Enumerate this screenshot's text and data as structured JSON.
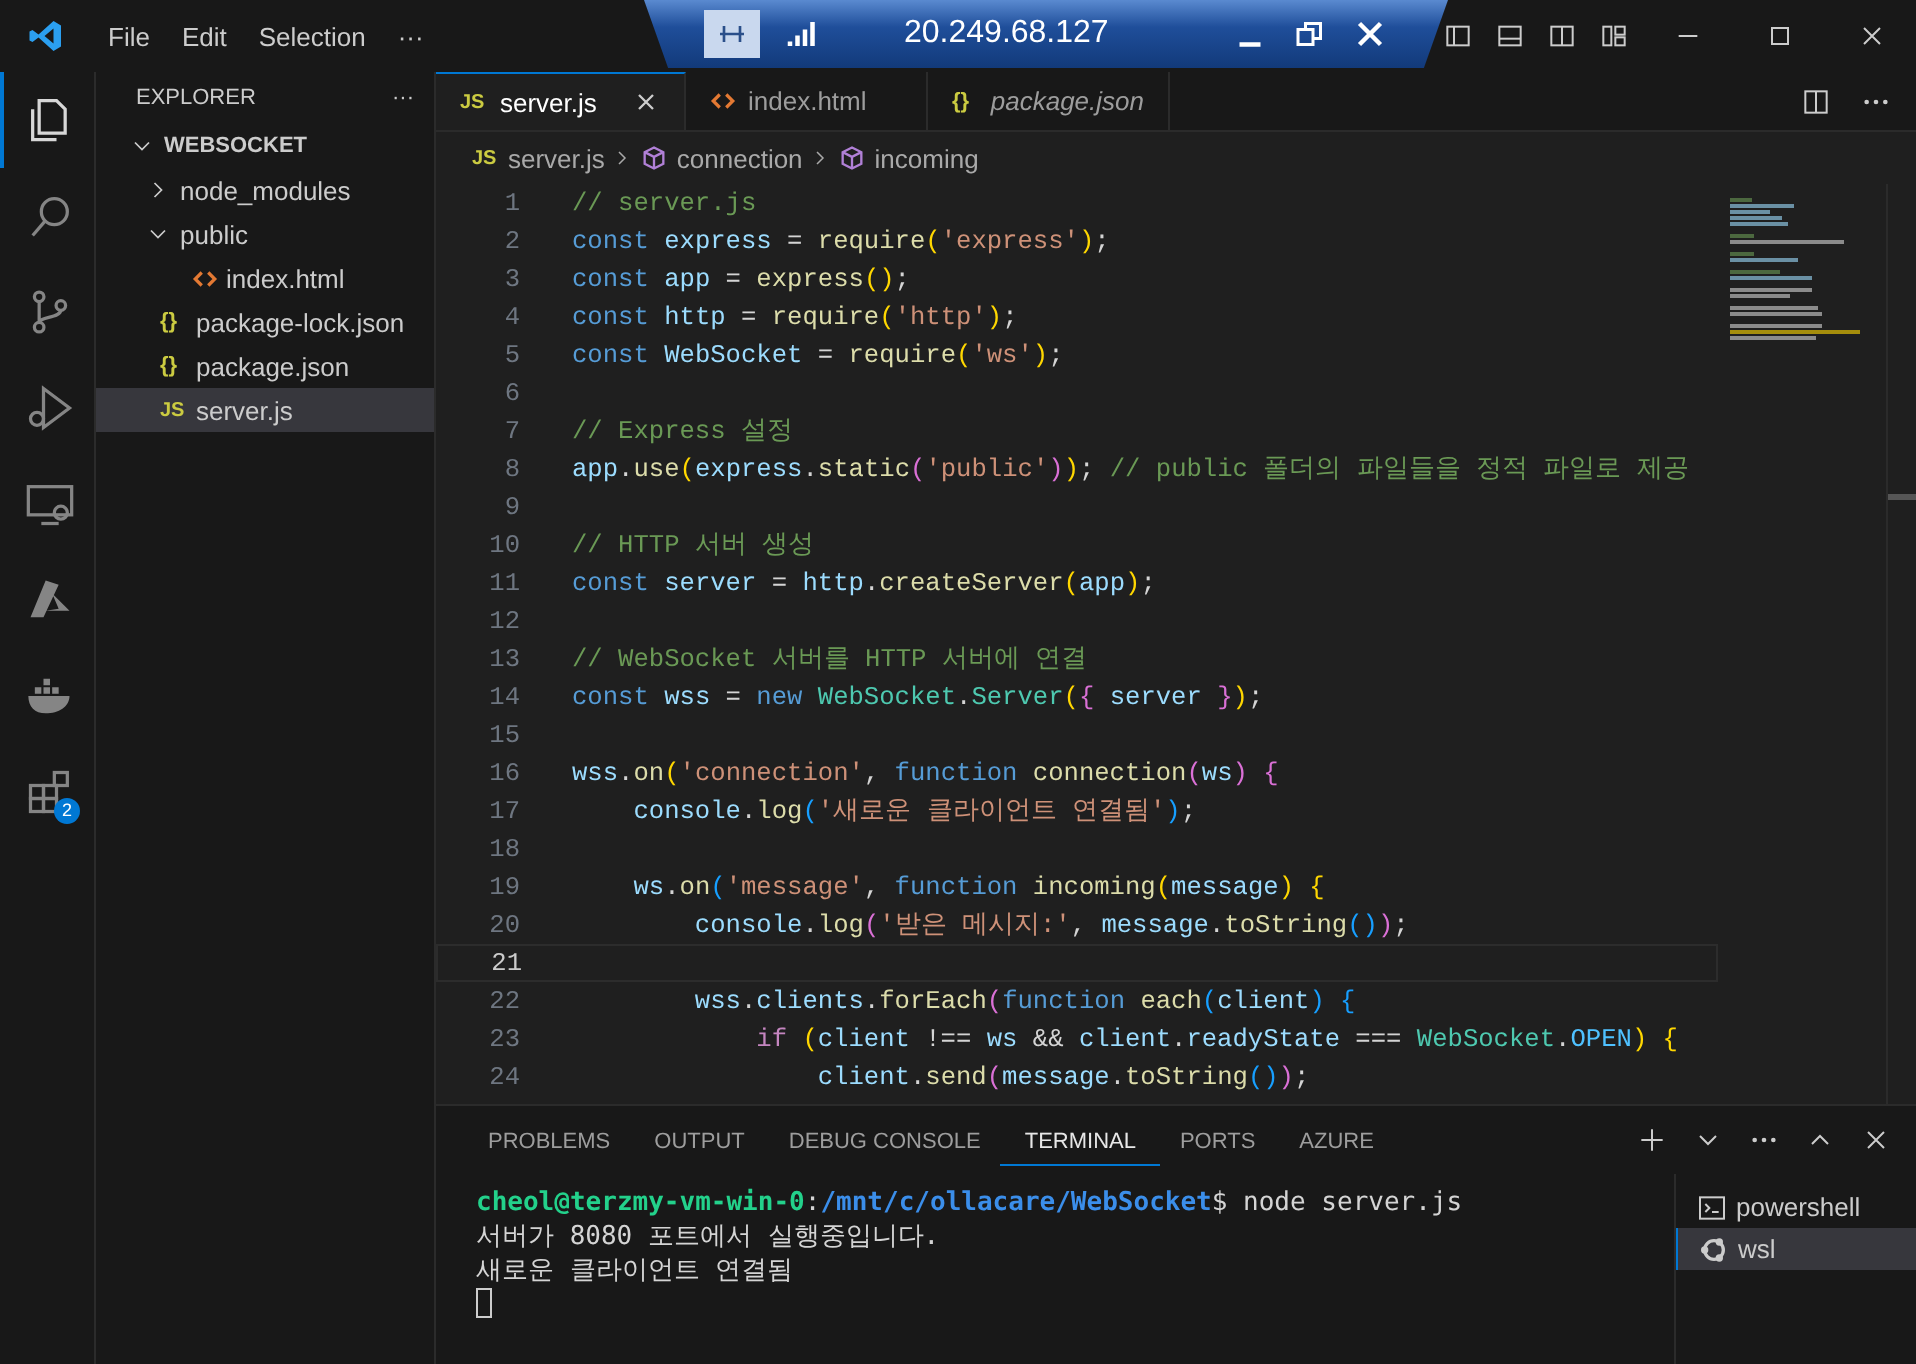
{
  "title_bar": {
    "menu": [
      "File",
      "Edit",
      "Selection",
      "···"
    ]
  },
  "remote_bar": {
    "address": "20.249.68.127"
  },
  "activity_bar": [
    {
      "selected": true
    },
    {
      "selected": false
    },
    {
      "selected": false
    },
    {
      "selected": false
    },
    {
      "selected": false
    },
    {
      "selected": false
    },
    {
      "selected": false
    },
    {
      "selected": false,
      "badge": "2"
    }
  ],
  "sidebar": {
    "title": "EXPLORER",
    "more": "···",
    "tree": [
      {
        "label": "WEBSOCKET",
        "kind": "root",
        "expanded": true,
        "selected": false,
        "children": [
          {
            "label": "node_modules",
            "kind": "folder",
            "expanded": false,
            "selected": false
          },
          {
            "label": "public",
            "kind": "folder",
            "expanded": true,
            "selected": false,
            "children": [
              {
                "label": "index.html",
                "kind": "html",
                "selected": false
              }
            ]
          },
          {
            "label": "package-lock.json",
            "kind": "json",
            "icon_text": "{}",
            "selected": false
          },
          {
            "label": "package.json",
            "kind": "json",
            "icon_text": "{}",
            "selected": false
          },
          {
            "label": "server.js",
            "kind": "js",
            "icon_text": "JS",
            "selected": true
          }
        ]
      }
    ]
  },
  "tabs": [
    {
      "label": "server.js",
      "kind": "js",
      "icon_text": "JS",
      "selected": true,
      "preview": false
    },
    {
      "label": "index.html",
      "kind": "html",
      "selected": false,
      "preview": false
    },
    {
      "label": "package.json",
      "kind": "json",
      "icon_text": "{}",
      "selected": false,
      "preview": true
    }
  ],
  "breadcrumbs": [
    {
      "label": "server.js",
      "kind": "js",
      "icon_text": "JS"
    },
    {
      "label": "connection",
      "kind": "symbol"
    },
    {
      "label": "incoming",
      "kind": "symbol"
    }
  ],
  "code": [
    {
      "n": "1",
      "current": false,
      "tokens": [
        {
          "kind": "cm",
          "t": "// server.js"
        }
      ]
    },
    {
      "n": "2",
      "current": false,
      "tokens": [
        {
          "kind": "kw",
          "t": "const"
        },
        {
          "kind": "var",
          "t": " express"
        },
        {
          "kind": "p",
          "t": " = "
        },
        {
          "kind": "fn",
          "t": "require"
        },
        {
          "kind": "b1",
          "t": "("
        },
        {
          "kind": "str",
          "t": "'express'"
        },
        {
          "kind": "b1",
          "t": ")"
        },
        {
          "kind": "p",
          "t": ";"
        }
      ]
    },
    {
      "n": "3",
      "current": false,
      "tokens": [
        {
          "kind": "kw",
          "t": "const"
        },
        {
          "kind": "var",
          "t": " app"
        },
        {
          "kind": "p",
          "t": " = "
        },
        {
          "kind": "fn",
          "t": "express"
        },
        {
          "kind": "b1",
          "t": "()"
        },
        {
          "kind": "p",
          "t": ";"
        }
      ]
    },
    {
      "n": "4",
      "current": false,
      "tokens": [
        {
          "kind": "kw",
          "t": "const"
        },
        {
          "kind": "var",
          "t": " http"
        },
        {
          "kind": "p",
          "t": " = "
        },
        {
          "kind": "fn",
          "t": "require"
        },
        {
          "kind": "b1",
          "t": "("
        },
        {
          "kind": "str",
          "t": "'http'"
        },
        {
          "kind": "b1",
          "t": ")"
        },
        {
          "kind": "p",
          "t": ";"
        }
      ]
    },
    {
      "n": "5",
      "current": false,
      "tokens": [
        {
          "kind": "kw",
          "t": "const"
        },
        {
          "kind": "var",
          "t": " WebSocket"
        },
        {
          "kind": "p",
          "t": " = "
        },
        {
          "kind": "fn",
          "t": "require"
        },
        {
          "kind": "b1",
          "t": "("
        },
        {
          "kind": "str",
          "t": "'ws'"
        },
        {
          "kind": "b1",
          "t": ")"
        },
        {
          "kind": "p",
          "t": ";"
        }
      ]
    },
    {
      "n": "6",
      "current": false
    },
    {
      "n": "7",
      "current": false,
      "tokens": [
        {
          "kind": "cm",
          "t": "// Express 설정"
        }
      ]
    },
    {
      "n": "8",
      "current": false,
      "tokens": [
        {
          "kind": "var",
          "t": "app"
        },
        {
          "kind": "p",
          "t": "."
        },
        {
          "kind": "fn",
          "t": "use"
        },
        {
          "kind": "b1",
          "t": "("
        },
        {
          "kind": "var",
          "t": "express"
        },
        {
          "kind": "p",
          "t": "."
        },
        {
          "kind": "fn",
          "t": "static"
        },
        {
          "kind": "b2",
          "t": "("
        },
        {
          "kind": "str",
          "t": "'public'"
        },
        {
          "kind": "b2",
          "t": ")"
        },
        {
          "kind": "b1",
          "t": ")"
        },
        {
          "kind": "p",
          "t": "; "
        },
        {
          "kind": "cm",
          "t": "// public 폴더의 파일들을 정적 파일로 제공"
        }
      ]
    },
    {
      "n": "9",
      "current": false
    },
    {
      "n": "10",
      "current": false,
      "tokens": [
        {
          "kind": "cm",
          "t": "// HTTP 서버 생성"
        }
      ]
    },
    {
      "n": "11",
      "current": false,
      "tokens": [
        {
          "kind": "kw",
          "t": "const"
        },
        {
          "kind": "var",
          "t": " server"
        },
        {
          "kind": "p",
          "t": " = "
        },
        {
          "kind": "var",
          "t": "http"
        },
        {
          "kind": "p",
          "t": "."
        },
        {
          "kind": "fn",
          "t": "createServer"
        },
        {
          "kind": "b1",
          "t": "("
        },
        {
          "kind": "var",
          "t": "app"
        },
        {
          "kind": "b1",
          "t": ")"
        },
        {
          "kind": "p",
          "t": ";"
        }
      ]
    },
    {
      "n": "12",
      "current": false
    },
    {
      "n": "13",
      "current": false,
      "tokens": [
        {
          "kind": "cm",
          "t": "// WebSocket 서버를 HTTP 서버에 연결"
        }
      ]
    },
    {
      "n": "14",
      "current": false,
      "tokens": [
        {
          "kind": "kw",
          "t": "const"
        },
        {
          "kind": "var",
          "t": " wss"
        },
        {
          "kind": "p",
          "t": " = "
        },
        {
          "kind": "kw",
          "t": "new"
        },
        {
          "kind": "cls",
          "t": " WebSocket"
        },
        {
          "kind": "p",
          "t": "."
        },
        {
          "kind": "cls",
          "t": "Server"
        },
        {
          "kind": "b1",
          "t": "("
        },
        {
          "kind": "b2",
          "t": "{"
        },
        {
          "kind": "var",
          "t": " server "
        },
        {
          "kind": "b2",
          "t": "}"
        },
        {
          "kind": "b1",
          "t": ")"
        },
        {
          "kind": "p",
          "t": ";"
        }
      ]
    },
    {
      "n": "15",
      "current": false
    },
    {
      "n": "16",
      "current": false,
      "tokens": [
        {
          "kind": "var",
          "t": "wss"
        },
        {
          "kind": "p",
          "t": "."
        },
        {
          "kind": "fn",
          "t": "on"
        },
        {
          "kind": "b1",
          "t": "("
        },
        {
          "kind": "str",
          "t": "'connection'"
        },
        {
          "kind": "p",
          "t": ", "
        },
        {
          "kind": "kw",
          "t": "function"
        },
        {
          "kind": "fn",
          "t": " connection"
        },
        {
          "kind": "b2",
          "t": "("
        },
        {
          "kind": "var",
          "t": "ws"
        },
        {
          "kind": "b2",
          "t": ")"
        },
        {
          "kind": "b2",
          "t": " {"
        }
      ]
    },
    {
      "n": "17",
      "current": false,
      "tokens": [
        {
          "kind": "var",
          "t": "    console"
        },
        {
          "kind": "p",
          "t": "."
        },
        {
          "kind": "fn",
          "t": "log"
        },
        {
          "kind": "b3",
          "t": "("
        },
        {
          "kind": "str",
          "t": "'새로운 클라이언트 연결됨'"
        },
        {
          "kind": "b3",
          "t": ")"
        },
        {
          "kind": "p",
          "t": ";"
        }
      ]
    },
    {
      "n": "18",
      "current": false
    },
    {
      "n": "19",
      "current": false,
      "tokens": [
        {
          "kind": "var",
          "t": "    ws"
        },
        {
          "kind": "p",
          "t": "."
        },
        {
          "kind": "fn",
          "t": "on"
        },
        {
          "kind": "b3",
          "t": "("
        },
        {
          "kind": "str",
          "t": "'message'"
        },
        {
          "kind": "p",
          "t": ", "
        },
        {
          "kind": "kw",
          "t": "function"
        },
        {
          "kind": "fn",
          "t": " incoming"
        },
        {
          "kind": "b1",
          "t": "("
        },
        {
          "kind": "var",
          "t": "message"
        },
        {
          "kind": "b1",
          "t": ")"
        },
        {
          "kind": "b1",
          "t": " {"
        }
      ]
    },
    {
      "n": "20",
      "current": false,
      "tokens": [
        {
          "kind": "var",
          "t": "        console"
        },
        {
          "kind": "p",
          "t": "."
        },
        {
          "kind": "fn",
          "t": "log"
        },
        {
          "kind": "b2",
          "t": "("
        },
        {
          "kind": "str",
          "t": "'받은 메시지:'"
        },
        {
          "kind": "p",
          "t": ", "
        },
        {
          "kind": "var",
          "t": "message"
        },
        {
          "kind": "p",
          "t": "."
        },
        {
          "kind": "fn",
          "t": "toString"
        },
        {
          "kind": "b3",
          "t": "()"
        },
        {
          "kind": "b2",
          "t": ")"
        },
        {
          "kind": "p",
          "t": ";"
        }
      ]
    },
    {
      "n": "21",
      "current": true
    },
    {
      "n": "22",
      "current": false,
      "tokens": [
        {
          "kind": "var",
          "t": "        wss"
        },
        {
          "kind": "p",
          "t": "."
        },
        {
          "kind": "var",
          "t": "clients"
        },
        {
          "kind": "p",
          "t": "."
        },
        {
          "kind": "fn",
          "t": "forEach"
        },
        {
          "kind": "b2",
          "t": "("
        },
        {
          "kind": "kw",
          "t": "function"
        },
        {
          "kind": "fn",
          "t": " each"
        },
        {
          "kind": "b3",
          "t": "("
        },
        {
          "kind": "var",
          "t": "client"
        },
        {
          "kind": "b3",
          "t": ")"
        },
        {
          "kind": "b3",
          "t": " {"
        }
      ]
    },
    {
      "n": "23",
      "current": false,
      "tokens": [
        {
          "kind": "ctl",
          "t": "            if"
        },
        {
          "kind": "b1",
          "t": " ("
        },
        {
          "kind": "var",
          "t": "client"
        },
        {
          "kind": "p",
          "t": " !== "
        },
        {
          "kind": "var",
          "t": "ws"
        },
        {
          "kind": "p",
          "t": " && "
        },
        {
          "kind": "var",
          "t": "client"
        },
        {
          "kind": "p",
          "t": "."
        },
        {
          "kind": "var",
          "t": "readyState"
        },
        {
          "kind": "p",
          "t": " === "
        },
        {
          "kind": "cls",
          "t": "WebSocket"
        },
        {
          "kind": "p",
          "t": "."
        },
        {
          "kind": "const",
          "t": "OPEN"
        },
        {
          "kind": "b1",
          "t": ")"
        },
        {
          "kind": "b1",
          "t": " {"
        }
      ]
    },
    {
      "n": "24",
      "current": false,
      "tokens": [
        {
          "kind": "var",
          "t": "                client"
        },
        {
          "kind": "p",
          "t": "."
        },
        {
          "kind": "fn",
          "t": "send"
        },
        {
          "kind": "b2",
          "t": "("
        },
        {
          "kind": "var",
          "t": "message"
        },
        {
          "kind": "p",
          "t": "."
        },
        {
          "kind": "fn",
          "t": "toString"
        },
        {
          "kind": "b3",
          "t": "()"
        },
        {
          "kind": "b2",
          "t": ")"
        },
        {
          "kind": "p",
          "t": ";"
        }
      ]
    }
  ],
  "panel": {
    "tabs": [
      {
        "label": "PROBLEMS",
        "selected": false
      },
      {
        "label": "OUTPUT",
        "selected": false
      },
      {
        "label": "DEBUG CONSOLE",
        "selected": false
      },
      {
        "label": "TERMINAL",
        "selected": true
      },
      {
        "label": "PORTS",
        "selected": false
      },
      {
        "label": "AZURE",
        "selected": false
      }
    ],
    "terminal_lines": [
      [
        {
          "kind": "user",
          "t": "cheol@terzmy-vm-win-0"
        },
        {
          "kind": "p",
          "t": ":"
        },
        {
          "kind": "path",
          "t": "/mnt/c/ollacare/WebSocket"
        },
        {
          "kind": "p",
          "t": "$ node server.js"
        }
      ],
      [
        {
          "kind": "p",
          "t": "서버가 8080 포트에서 실행중입니다."
        }
      ],
      [
        {
          "kind": "p",
          "t": "새로운 클라이언트 연결됨"
        }
      ]
    ],
    "terminals": [
      {
        "label": "powershell",
        "kind": "powershell",
        "selected": false
      },
      {
        "label": "wsl",
        "kind": "linux",
        "selected": true
      }
    ]
  }
}
